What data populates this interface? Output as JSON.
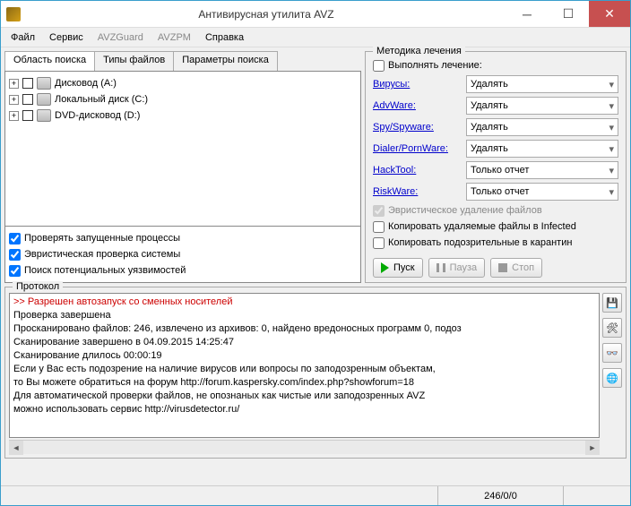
{
  "window": {
    "title": "Антивирусная утилита AVZ"
  },
  "menu": [
    "Файл",
    "Сервис",
    "AVZGuard",
    "AVZPM",
    "Справка"
  ],
  "menu_disabled": [
    false,
    false,
    true,
    true,
    false
  ],
  "tabs": [
    "Область поиска",
    "Типы файлов",
    "Параметры поиска"
  ],
  "drives": [
    {
      "label": "Дисковод (A:)"
    },
    {
      "label": "Локальный диск (C:)"
    },
    {
      "label": "DVD-дисковод (D:)"
    }
  ],
  "checks": [
    "Проверять запущенные процессы",
    "Эвристическая проверка системы",
    "Поиск потенциальных уязвимостей"
  ],
  "treatment": {
    "group": "Методика лечения",
    "perform": "Выполнять лечение:",
    "rows": [
      {
        "label": "Вирусы:",
        "action": "Удалять"
      },
      {
        "label": "AdvWare:",
        "action": "Удалять"
      },
      {
        "label": "Spy/Spyware:",
        "action": "Удалять"
      },
      {
        "label": "Dialer/PornWare:",
        "action": "Удалять"
      },
      {
        "label": "HackTool:",
        "action": "Только отчет"
      },
      {
        "label": "RiskWare:",
        "action": "Только отчет"
      }
    ],
    "heuristic": "Эвристическое удаление файлов",
    "copy_infected": "Копировать удаляемые файлы в  Infected",
    "copy_quarantine": "Копировать подозрительные в  карантин"
  },
  "buttons": {
    "start": "Пуск",
    "pause": "Пауза",
    "stop": "Стоп"
  },
  "protocol": {
    "label": "Протокол",
    "lines": [
      {
        "text": ">>  Разрешен автозапуск со сменных носителей",
        "warn": true
      },
      {
        "text": "Проверка завершена"
      },
      {
        "text": "Просканировано файлов: 246, извлечено из архивов: 0, найдено вредоносных программ 0, подоз"
      },
      {
        "text": "Сканирование завершено в 04.09.2015 14:25:47"
      },
      {
        "text": "Сканирование длилось 00:00:19"
      },
      {
        "text": "Если у Вас есть подозрение на наличие вирусов или вопросы по заподозренным объектам,"
      },
      {
        "text": "то Вы можете обратиться на форум http://forum.kaspersky.com/index.php?showforum=18"
      },
      {
        "text": "Для автоматической проверки файлов, не опознаных как чистые или заподозренных AVZ"
      },
      {
        "text": "можно использовать сервис http://virusdetector.ru/"
      }
    ]
  },
  "status": "246/0/0"
}
